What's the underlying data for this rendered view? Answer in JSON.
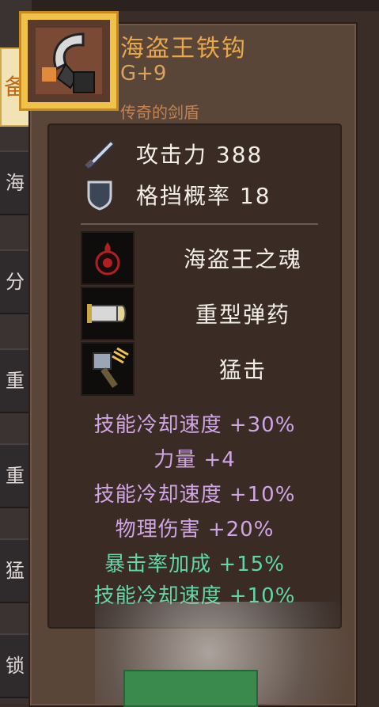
{
  "sidebar": {
    "tabs": [
      {
        "label": "海"
      },
      {
        "label": "分"
      },
      {
        "label": "重"
      },
      {
        "label": "重"
      },
      {
        "label": "猛"
      },
      {
        "label": "锁"
      }
    ],
    "active_label": "备"
  },
  "item": {
    "name": "海盗王铁钩",
    "level": "G+9",
    "rarity": "传奇的剑盾",
    "icon": "pirate-hook-icon"
  },
  "stats": [
    {
      "icon": "sword-icon",
      "text": "攻击力 388"
    },
    {
      "icon": "shield-icon",
      "text": "格挡概率 18"
    }
  ],
  "skills": [
    {
      "icon": "dark-soul-icon",
      "name": "海盗王之魂"
    },
    {
      "icon": "heavy-ammo-icon",
      "name": "重型弹药"
    },
    {
      "icon": "hammer-strike-icon",
      "name": "猛击"
    }
  ],
  "bonuses": [
    {
      "text": "技能冷却速度 +30%",
      "color": "purple"
    },
    {
      "text": "力量 +4",
      "color": "purple"
    },
    {
      "text": "技能冷却速度 +10%",
      "color": "purple"
    },
    {
      "text": "物理伤害 +20%",
      "color": "purple"
    },
    {
      "text": "暴击率加成 +15%",
      "color": "green"
    },
    {
      "text": "技能冷却速度 +10%",
      "color": "green"
    }
  ],
  "colors": {
    "name": "#e7a84a",
    "purple": "#cfa6e3",
    "green": "#62d6a9",
    "panel": "#5a4539"
  }
}
